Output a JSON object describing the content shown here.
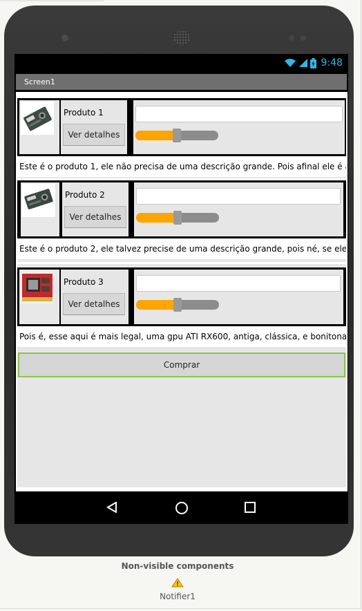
{
  "status": {
    "time": "9:48"
  },
  "screen_title": "Screen1",
  "products": [
    {
      "name": "Produto 1",
      "button": "Ver detalhes",
      "description": "Este é o produto 1, ele não precisa de uma descrição grande. Pois afinal ele é apenas",
      "slider_value": 0.5,
      "image": "audio-di-box-image"
    },
    {
      "name": "Produto 2",
      "button": "Ver detalhes",
      "description": "Este é o produto 2, ele talvez precise de uma descrição grande, pois né, se ele fosse",
      "slider_value": 0.5,
      "image": "audio-di-box-image"
    },
    {
      "name": "Produto 3",
      "button": "Ver detalhes",
      "description": "Pois é, esse aqui é mais legal, uma gpu ATI RX600, antiga, clássica, e bonitona. Gran",
      "slider_value": 0.5,
      "image": "gpu-card-image"
    }
  ],
  "buy_button": "Comprar",
  "non_visible": {
    "title": "Non-visible components",
    "items": [
      {
        "label": "Notifier1",
        "icon": "warning-icon"
      }
    ]
  },
  "colors": {
    "slider_fill": "#ffa500",
    "slider_track": "#8c8c8c",
    "buy_border": "#8bc34a",
    "clock": "#33b5e5",
    "titlebar": "#6f6f6f"
  }
}
